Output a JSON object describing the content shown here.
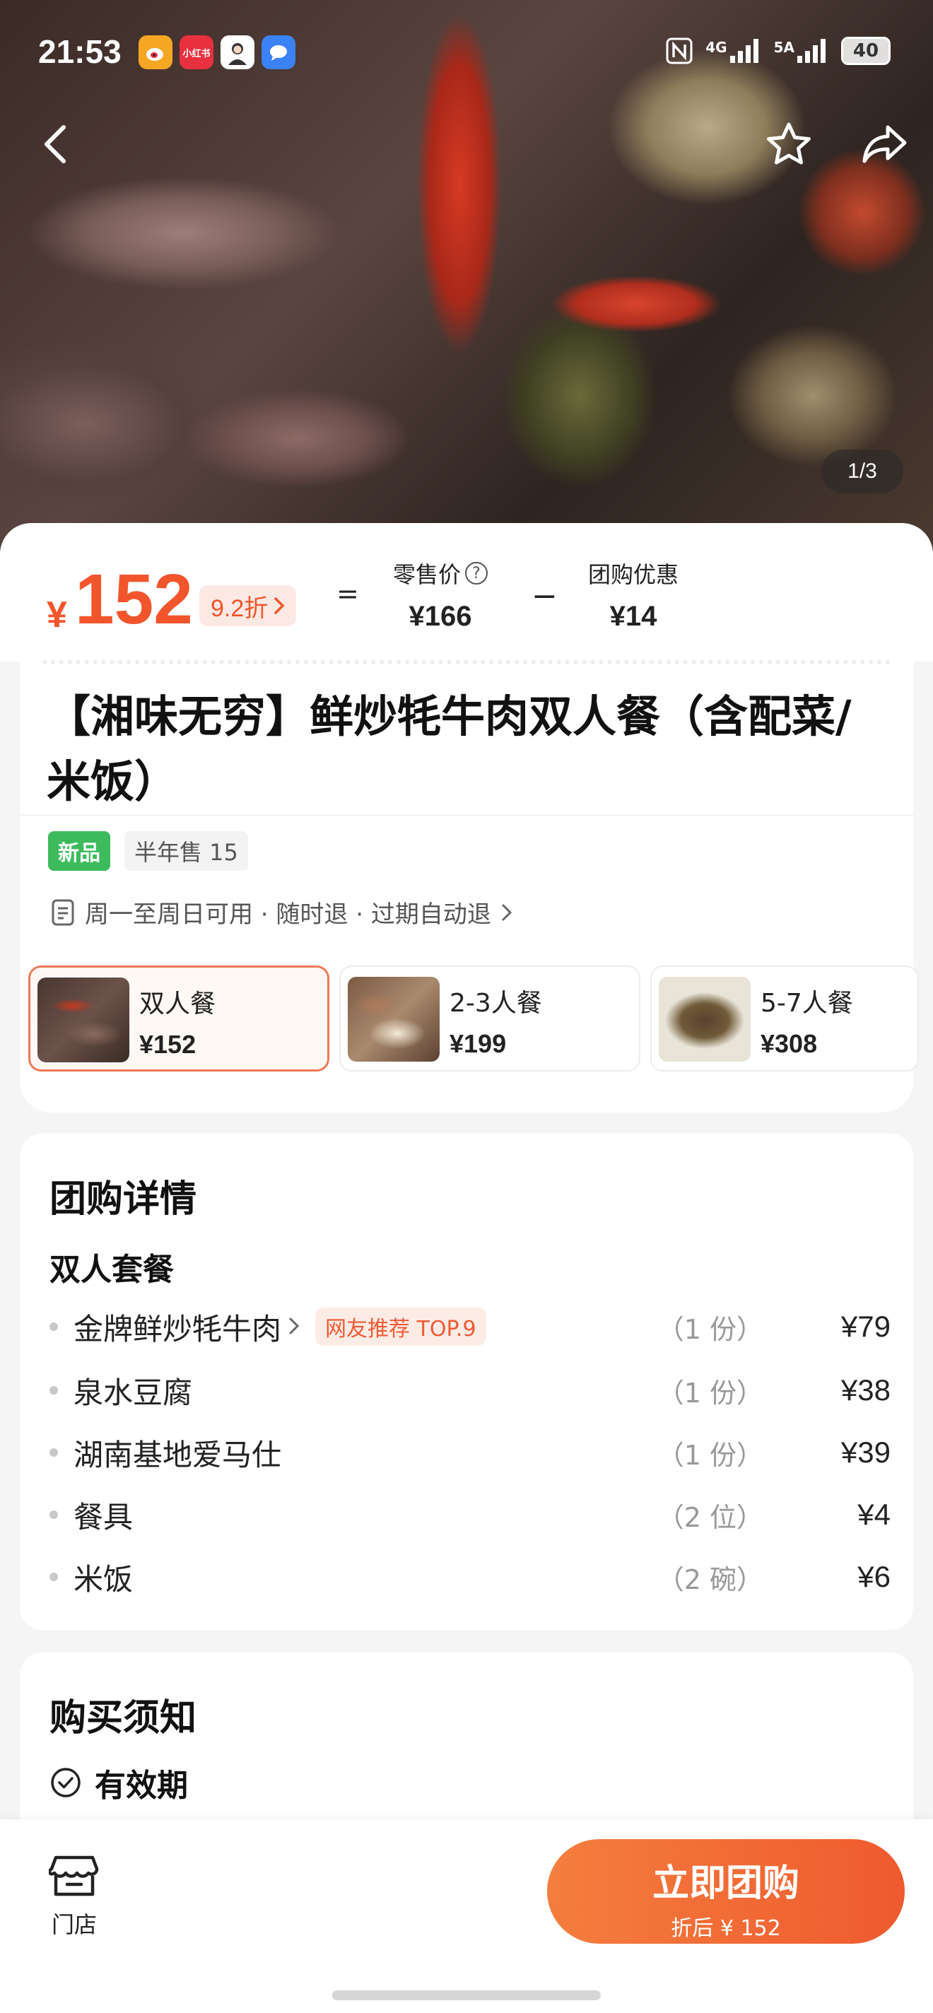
{
  "status_bar": {
    "time": "21:53",
    "apps": [
      {
        "icon": "weibo-icon",
        "color": "#f5a623",
        "label": ""
      },
      {
        "icon": "xiaohongshu-icon",
        "color": "#e8303f",
        "label": "小红书"
      },
      {
        "icon": "avatar-app-icon",
        "color": "#ffffff",
        "label": ""
      },
      {
        "icon": "message-app-icon",
        "color": "#3b82f6",
        "label": ""
      }
    ],
    "signal_1": "4G",
    "signal_2": "5A",
    "battery": "40"
  },
  "hero": {
    "image_counter": "1/3"
  },
  "price": {
    "currency": "¥",
    "amount": "152",
    "discount": "9.2折",
    "equals": "=",
    "retail_label": "零售价",
    "retail_value": "¥166",
    "minus": "−",
    "group_label": "团购优惠",
    "group_value": "¥14"
  },
  "product": {
    "title": "【湘味无穷】鲜炒牦牛肉双人餐（含配菜/米饭）",
    "tag_new": "新品",
    "tag_sold": "半年售 15",
    "rules": "周一至周日可用 · 随时退 · 过期自动退"
  },
  "options": [
    {
      "name": "双人餐",
      "price": "¥152",
      "selected": true
    },
    {
      "name": "2-3人餐",
      "price": "¥199",
      "selected": false
    },
    {
      "name": "5-7人餐",
      "price": "¥308",
      "selected": false
    }
  ],
  "detail": {
    "title": "团购详情",
    "set_name": "双人套餐",
    "items": [
      {
        "name": "金牌鲜炒牦牛肉",
        "badge": "网友推荐 TOP.9",
        "qty": "（1 份）",
        "price": "¥79"
      },
      {
        "name": "泉水豆腐",
        "qty": "（1 份）",
        "price": "¥38"
      },
      {
        "name": "湖南基地爱马仕",
        "qty": "（1 份）",
        "price": "¥39"
      },
      {
        "name": "餐具",
        "qty": "（2 位）",
        "price": "¥4"
      },
      {
        "name": "米饭",
        "qty": "（2 碗）",
        "price": "¥6"
      }
    ]
  },
  "notice": {
    "title": "购买须知",
    "validity": "有效期"
  },
  "bottom": {
    "store_label": "门店",
    "buy_label": "立即团购",
    "buy_sub": "折后 ¥ 152"
  }
}
